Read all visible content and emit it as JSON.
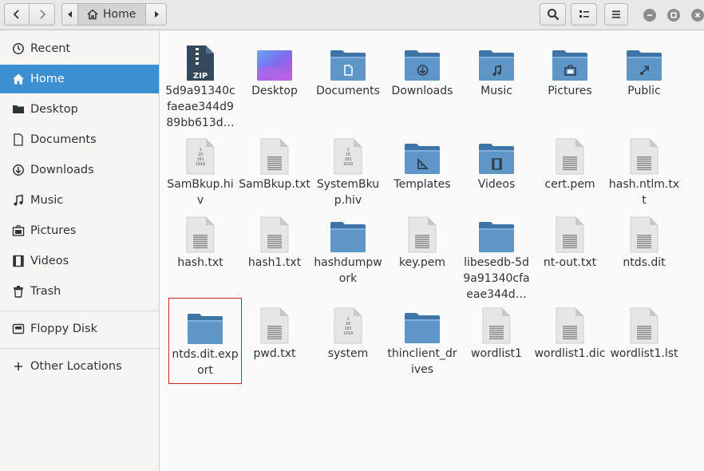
{
  "header": {
    "back_icon": "chevron-left-icon",
    "forward_icon": "chevron-right-icon",
    "path_current": "Home",
    "search_icon": "search-icon",
    "view_icon": "view-list-icon",
    "menu_icon": "hamburger-menu-icon"
  },
  "sidebar": {
    "places": [
      {
        "label": "Recent",
        "icon": "clock-icon"
      },
      {
        "label": "Home",
        "icon": "home-icon",
        "active": true
      },
      {
        "label": "Desktop",
        "icon": "folder-icon"
      },
      {
        "label": "Documents",
        "icon": "document-icon"
      },
      {
        "label": "Downloads",
        "icon": "download-icon"
      },
      {
        "label": "Music",
        "icon": "music-icon"
      },
      {
        "label": "Pictures",
        "icon": "picture-icon"
      },
      {
        "label": "Videos",
        "icon": "video-icon"
      },
      {
        "label": "Trash",
        "icon": "trash-icon"
      }
    ],
    "devices": [
      {
        "label": "Floppy Disk",
        "icon": "floppy-icon"
      }
    ],
    "other": {
      "label": "Other Locations",
      "icon": "plus-icon"
    }
  },
  "files": [
    {
      "name": "5d9a91340cfaeae344d989bb613d…",
      "type": "zip"
    },
    {
      "name": "Desktop",
      "type": "desktop"
    },
    {
      "name": "Documents",
      "type": "folder-documents"
    },
    {
      "name": "Downloads",
      "type": "folder-downloads"
    },
    {
      "name": "Music",
      "type": "folder-music"
    },
    {
      "name": "Pictures",
      "type": "folder-pictures"
    },
    {
      "name": "Public",
      "type": "folder-public"
    },
    {
      "name": "SamBkup.hiv",
      "type": "binary"
    },
    {
      "name": "SamBkup.txt",
      "type": "text"
    },
    {
      "name": "SystemBkup.hiv",
      "type": "binary"
    },
    {
      "name": "Templates",
      "type": "folder-templates"
    },
    {
      "name": "Videos",
      "type": "folder-videos"
    },
    {
      "name": "cert.pem",
      "type": "text"
    },
    {
      "name": "hash.ntlm.txt",
      "type": "text"
    },
    {
      "name": "hash.txt",
      "type": "text"
    },
    {
      "name": "hash1.txt",
      "type": "text"
    },
    {
      "name": "hashdumpwork",
      "type": "folder"
    },
    {
      "name": "key.pem",
      "type": "text"
    },
    {
      "name": "libesedb-5d9a91340cfaeae344d…",
      "type": "folder"
    },
    {
      "name": "nt-out.txt",
      "type": "text"
    },
    {
      "name": "ntds.dit",
      "type": "text"
    },
    {
      "name": "ntds.dit.export",
      "type": "folder",
      "selected": true
    },
    {
      "name": "pwd.txt",
      "type": "text"
    },
    {
      "name": "system",
      "type": "binary"
    },
    {
      "name": "thinclient_drives",
      "type": "folder"
    },
    {
      "name": "wordlist1",
      "type": "text"
    },
    {
      "name": "wordlist1.dic",
      "type": "text"
    },
    {
      "name": "wordlist1.lst",
      "type": "text"
    }
  ],
  "colors": {
    "accent": "#3c8fd0",
    "folder": "#5a8ec1",
    "selection_border": "#cc2222"
  }
}
